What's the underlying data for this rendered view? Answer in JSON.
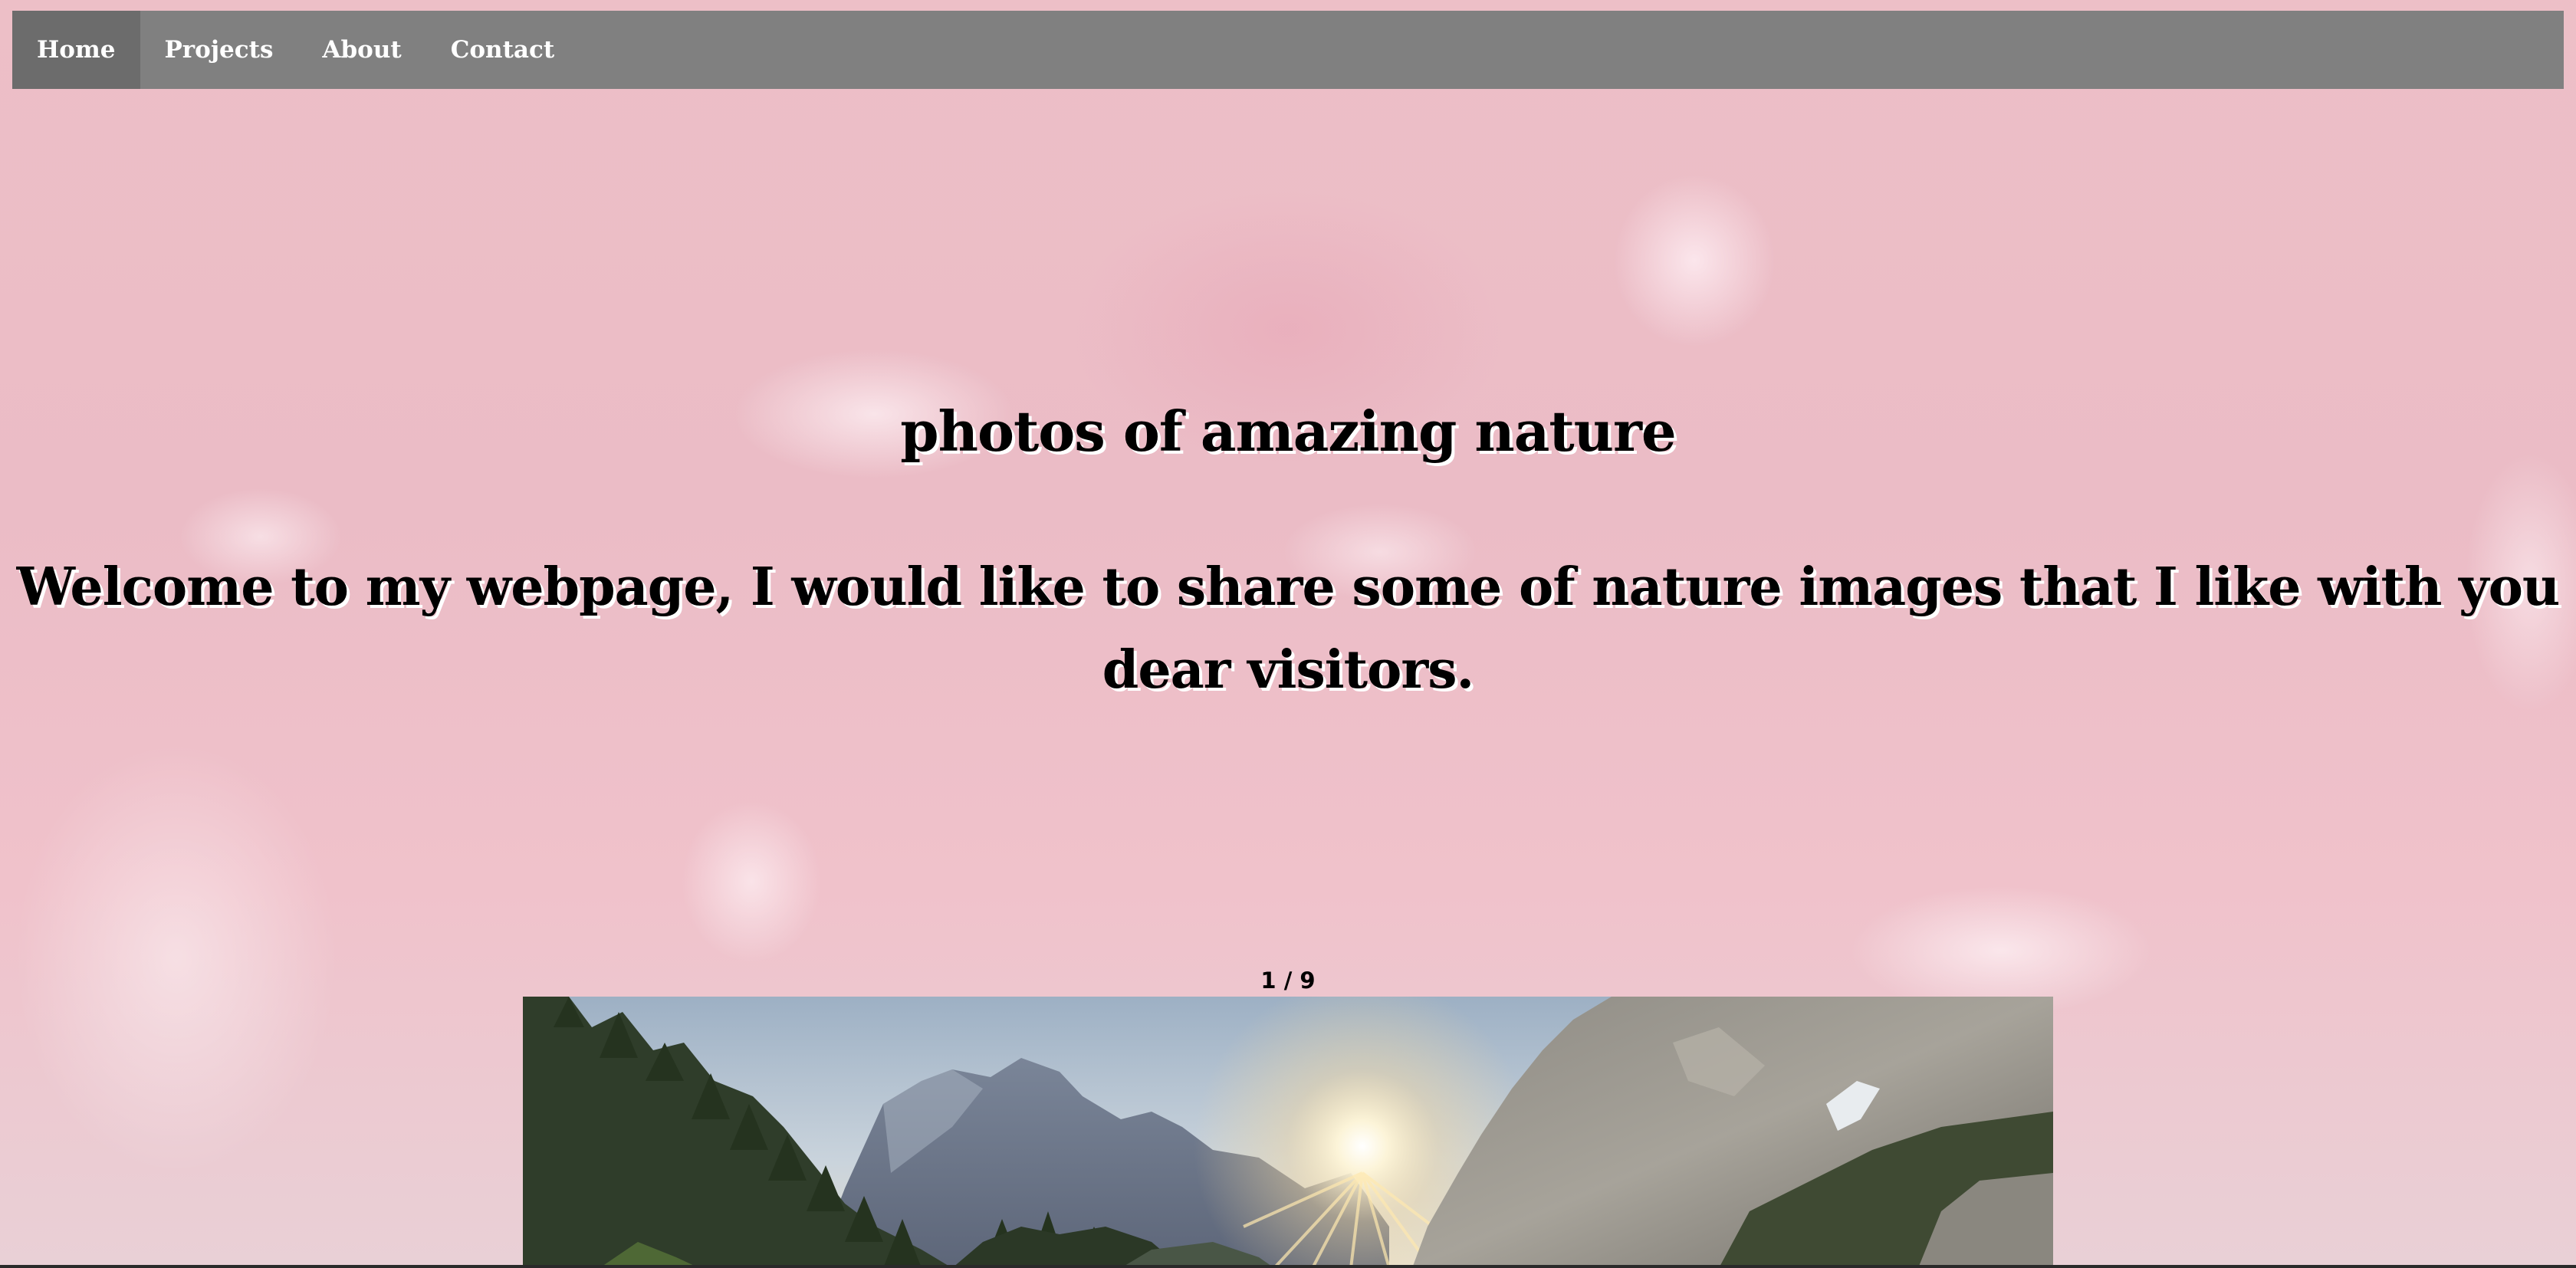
{
  "nav": {
    "items": [
      {
        "label": "Home",
        "active": true
      },
      {
        "label": "Projects",
        "active": false
      },
      {
        "label": "About",
        "active": false
      },
      {
        "label": "Contact",
        "active": false
      }
    ]
  },
  "hero": {
    "title": "photos of amazing nature",
    "subtitle": "Welcome to my webpage, I would like to share some of nature images that I like with you dear visitors."
  },
  "slideshow": {
    "counter": "1 / 9",
    "current_slide": 1,
    "total_slides": 9
  },
  "colors": {
    "navbar": "#808080",
    "nav_active": "#6c6c6c",
    "nav_text": "#ffffff",
    "heading_text": "#000000",
    "heading_shadow": "#ffffff",
    "page_background": "#ecc4cb"
  }
}
